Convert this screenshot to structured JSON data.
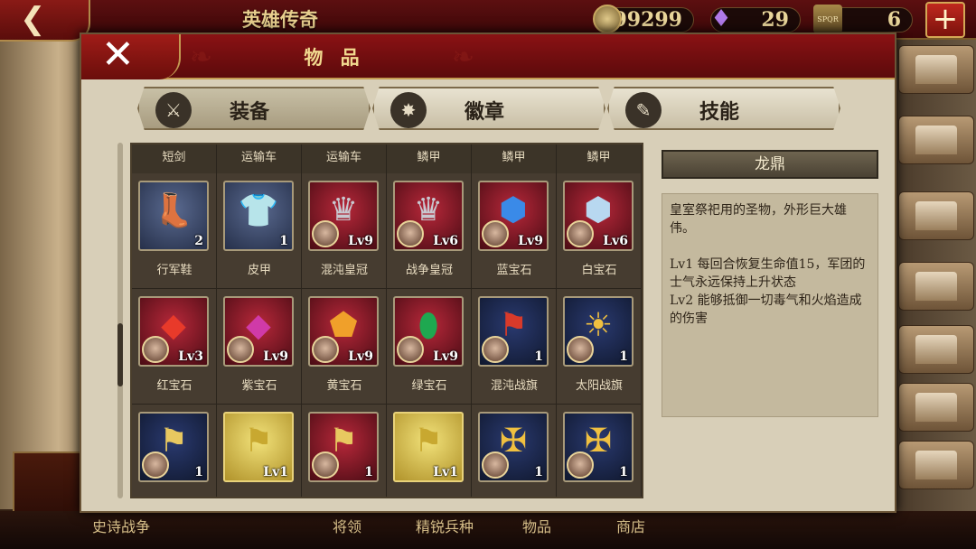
{
  "topbar": {
    "back_icon": "back-arrow-icon",
    "title": "英雄传奇",
    "coins": "99299",
    "gems": "29",
    "spqr": "6",
    "plus_icon": "plus-icon"
  },
  "panel": {
    "title": "物 品",
    "close_icon": "close-icon"
  },
  "tabs": [
    {
      "label": "装备",
      "icon": "helmet-swords-icon",
      "active": true
    },
    {
      "label": "徽章",
      "icon": "badge-icon",
      "active": false
    },
    {
      "label": "技能",
      "icon": "scroll-icon",
      "active": false
    }
  ],
  "grid": {
    "header_labels": [
      "短剑",
      "运输车",
      "运输车",
      "鳞甲",
      "鳞甲",
      "鳞甲"
    ],
    "rows": [
      [
        {
          "name": "行军鞋",
          "count": "2",
          "kind": "boots",
          "bg": "blue",
          "hero": false
        },
        {
          "name": "皮甲",
          "count": "1",
          "kind": "leather-armor",
          "bg": "blue",
          "hero": false
        },
        {
          "name": "混沌皇冠",
          "count": "Lv9",
          "kind": "crown",
          "bg": "red",
          "hero": true
        },
        {
          "name": "战争皇冠",
          "count": "Lv6",
          "kind": "crown",
          "bg": "red",
          "hero": true
        },
        {
          "name": "蓝宝石",
          "count": "Lv9",
          "kind": "gem-blue",
          "bg": "red",
          "hero": true
        },
        {
          "name": "白宝石",
          "count": "Lv6",
          "kind": "gem-white",
          "bg": "red",
          "hero": true
        }
      ],
      [
        {
          "name": "红宝石",
          "count": "Lv3",
          "kind": "gem-red",
          "bg": "red",
          "hero": true
        },
        {
          "name": "紫宝石",
          "count": "Lv9",
          "kind": "gem-purple",
          "bg": "red",
          "hero": true
        },
        {
          "name": "黄宝石",
          "count": "Lv9",
          "kind": "gem-yellow",
          "bg": "red",
          "hero": true
        },
        {
          "name": "绿宝石",
          "count": "Lv9",
          "kind": "gem-green",
          "bg": "red",
          "hero": true
        },
        {
          "name": "混沌战旗",
          "count": "1",
          "kind": "banner-chaos",
          "bg": "navy",
          "hero": true
        },
        {
          "name": "太阳战旗",
          "count": "1",
          "kind": "banner-sun",
          "bg": "navy",
          "hero": true
        }
      ],
      [
        {
          "name": "",
          "count": "1",
          "kind": "banner-legion",
          "bg": "navy",
          "hero": true
        },
        {
          "name": "",
          "count": "Lv1",
          "kind": "banner-caesar",
          "bg": "gold",
          "hero": false
        },
        {
          "name": "",
          "count": "1",
          "kind": "banner-legion-red",
          "bg": "red",
          "hero": true
        },
        {
          "name": "",
          "count": "Lv1",
          "kind": "banner-hannibal",
          "bg": "gold",
          "hero": false
        },
        {
          "name": "",
          "count": "1",
          "kind": "banner-eagle",
          "bg": "navy",
          "hero": true
        },
        {
          "name": "",
          "count": "1",
          "kind": "banner-eagle",
          "bg": "navy",
          "hero": true
        }
      ]
    ]
  },
  "detail": {
    "title": "龙鼎",
    "description": "皇室祭祀用的圣物，外形巨大雄伟。",
    "lv1": "Lv1  每回合恢复生命值15，军团的士气永远保持上升状态",
    "lv2": "Lv2  能够抵御一切毒气和火焰造成的伤害"
  },
  "bottom_nav": [
    "史诗战争",
    "将领",
    "精锐兵种",
    "物品",
    "商店"
  ]
}
